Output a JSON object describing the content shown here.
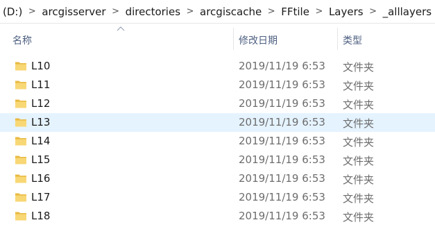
{
  "breadcrumb": {
    "drive": "(D:)",
    "items": [
      "arcgisserver",
      "directories",
      "arcgiscache",
      "FFtile",
      "Layers",
      "_alllayers"
    ],
    "separator": ">"
  },
  "columns": {
    "name": "名称",
    "date_modified": "修改日期",
    "type": "类型",
    "sorted_by": "name",
    "sort_direction": "ascending"
  },
  "rows": [
    {
      "name": "L10",
      "date": "2019/11/19 6:53",
      "type": "文件夹",
      "icon": "folder-icon",
      "selected": false
    },
    {
      "name": "L11",
      "date": "2019/11/19 6:53",
      "type": "文件夹",
      "icon": "folder-icon",
      "selected": false
    },
    {
      "name": "L12",
      "date": "2019/11/19 6:53",
      "type": "文件夹",
      "icon": "folder-icon",
      "selected": false
    },
    {
      "name": "L13",
      "date": "2019/11/19 6:53",
      "type": "文件夹",
      "icon": "folder-icon",
      "selected": true
    },
    {
      "name": "L14",
      "date": "2019/11/19 6:53",
      "type": "文件夹",
      "icon": "folder-icon",
      "selected": false
    },
    {
      "name": "L15",
      "date": "2019/11/19 6:53",
      "type": "文件夹",
      "icon": "folder-icon",
      "selected": false
    },
    {
      "name": "L16",
      "date": "2019/11/19 6:53",
      "type": "文件夹",
      "icon": "folder-icon",
      "selected": false
    },
    {
      "name": "L17",
      "date": "2019/11/19 6:53",
      "type": "文件夹",
      "icon": "folder-icon",
      "selected": false
    },
    {
      "name": "L18",
      "date": "2019/11/19 6:53",
      "type": "文件夹",
      "icon": "folder-icon",
      "selected": false
    }
  ],
  "colors": {
    "selected_row": "#e5f3ff",
    "header_text": "#4d5f80",
    "folder_fill": "#f8d775",
    "folder_shade": "#e8b941"
  }
}
